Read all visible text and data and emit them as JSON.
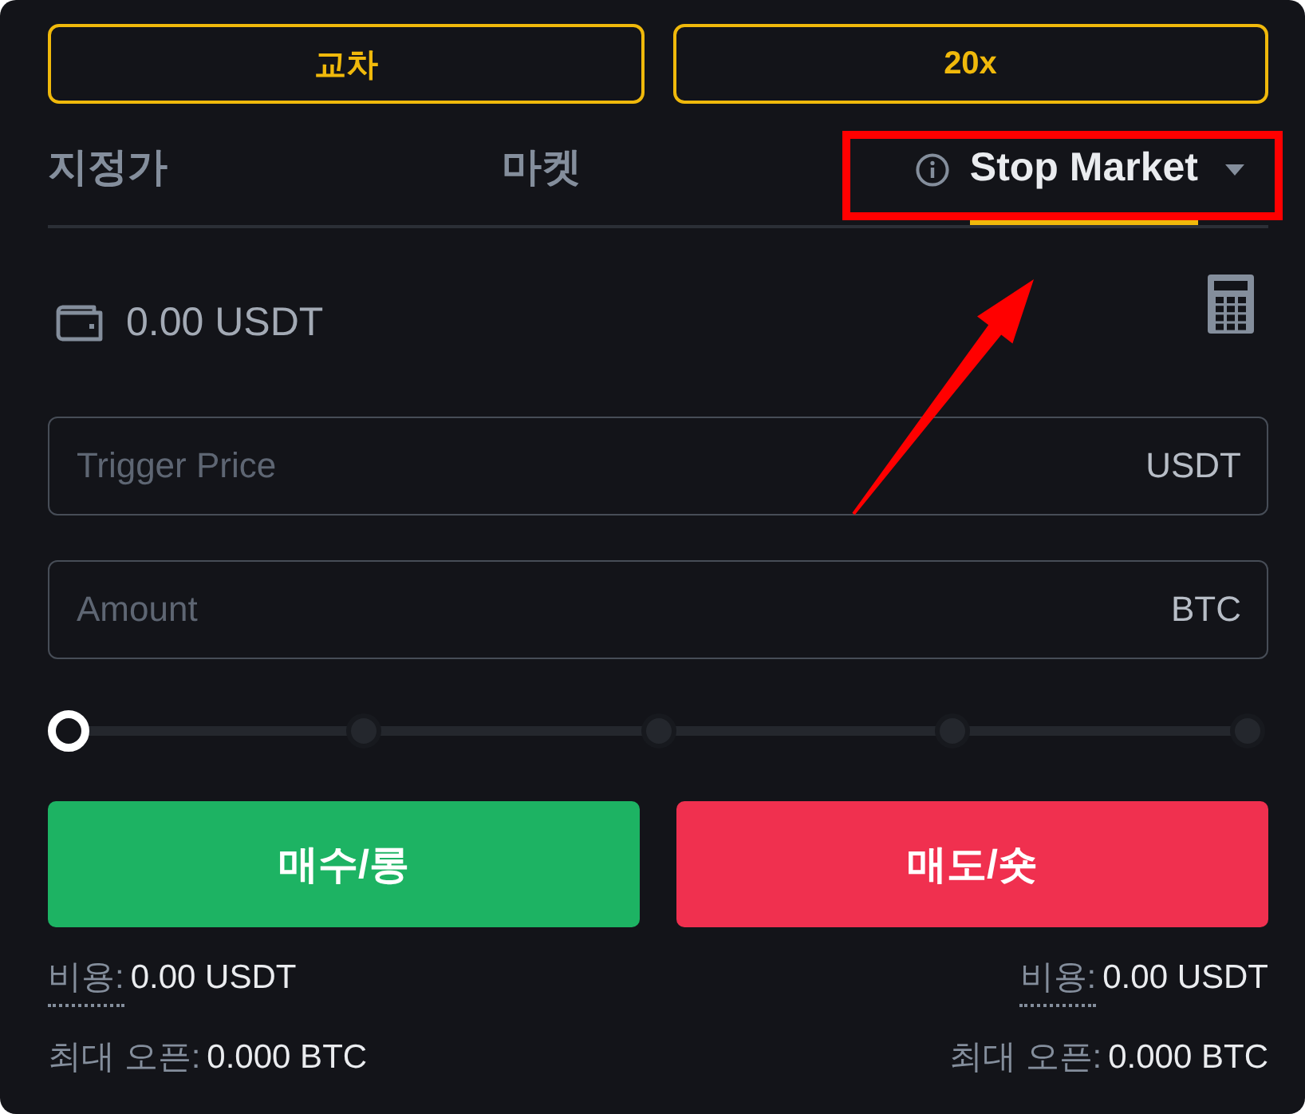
{
  "margin_buttons": [
    {
      "label": "교차"
    },
    {
      "label": "20x"
    }
  ],
  "order_tabs": [
    {
      "label": "지정가",
      "selected": false,
      "kind": "plain"
    },
    {
      "label": "마켓",
      "selected": false,
      "kind": "plain"
    },
    {
      "label": "Stop Market",
      "selected": true,
      "kind": "dropdown"
    }
  ],
  "balance": {
    "value": "0.00 USDT"
  },
  "fields": [
    {
      "placeholder": "Trigger Price",
      "unit": "USDT"
    },
    {
      "placeholder": "Amount",
      "unit": "BTC"
    }
  ],
  "slider": {
    "level": 0
  },
  "actions": [
    {
      "label": "매수/롱",
      "kind": "buy"
    },
    {
      "label": "매도/숏",
      "kind": "sell"
    }
  ],
  "summaries": [
    {
      "lines": [
        {
          "kind": "fee",
          "label": "비용:",
          "value": "0.00 USDT"
        },
        {
          "kind": "max_open",
          "label": "최대 오픈:",
          "value": "0.000 BTC"
        }
      ]
    },
    {
      "lines": [
        {
          "kind": "fee",
          "label": "비용:",
          "value": "0.00 USDT"
        },
        {
          "kind": "max_open",
          "label": "최대 오픈:",
          "value": "0.000 BTC"
        }
      ]
    }
  ]
}
